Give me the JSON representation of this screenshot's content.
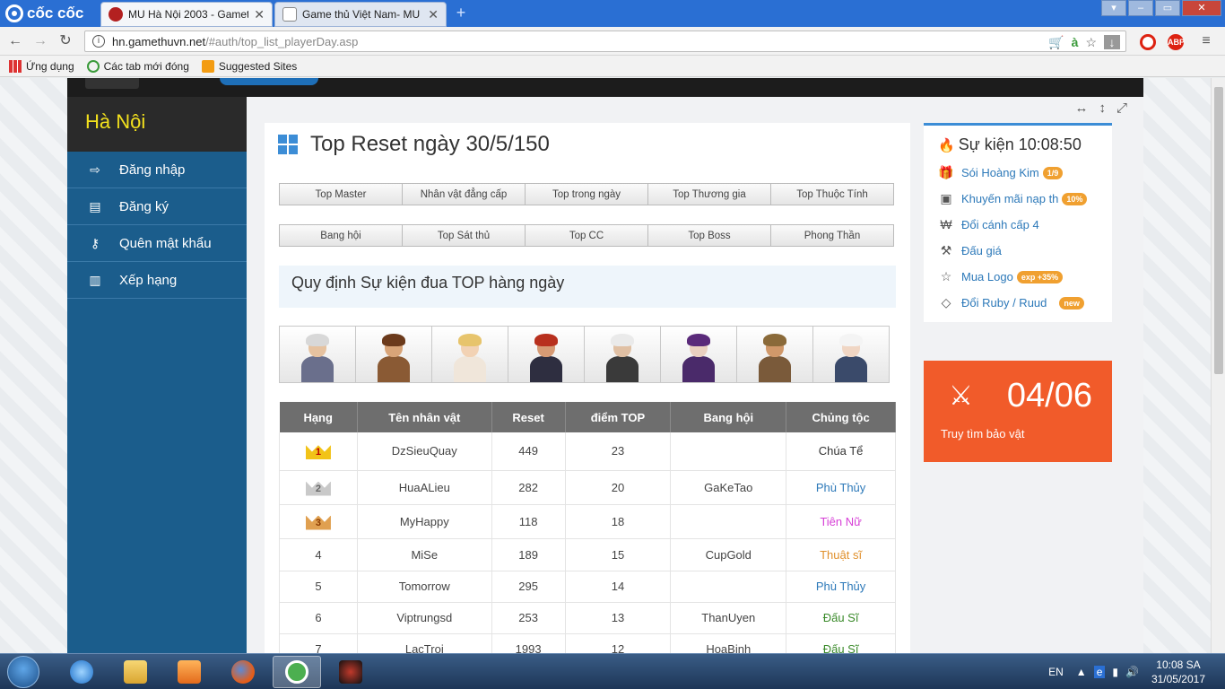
{
  "browser": {
    "brand": "cốc cốc",
    "tabs": [
      {
        "title": "MU Hà Nội 2003 - Gameth",
        "active": true
      },
      {
        "title": "Game thủ Việt Nam- MU H",
        "active": false
      }
    ],
    "url_host": "hn.gamethuvn.net",
    "url_path": "/#auth/top_list_playerDay.asp",
    "bookmarks": [
      "Ứng dụng",
      "Các tab mới đóng",
      "Suggested Sites"
    ]
  },
  "sidebar": {
    "title": "Hà Nội",
    "items": [
      {
        "label": "Đăng nhập",
        "icon": "sign-in-icon"
      },
      {
        "label": "Đăng ký",
        "icon": "document-icon"
      },
      {
        "label": "Quên mật khẩu",
        "icon": "key-icon"
      },
      {
        "label": "Xếp hạng",
        "icon": "bar-chart-icon"
      }
    ]
  },
  "main": {
    "title": "Top Reset ngày 30/5/150",
    "tabs_row1": [
      "Top Master",
      "Nhân vật đẳng cấp",
      "Top trong ngày",
      "Top Thương gia",
      "Top Thuộc Tính"
    ],
    "tabs_row2": [
      "Bang hội",
      "Top Sát thủ",
      "Top CC",
      "Top Boss",
      "Phong Thần"
    ],
    "rules_link": "Quy định Sự kiện đua TOP hàng ngày"
  },
  "table": {
    "headers": [
      "Hạng",
      "Tên nhân vật",
      "Reset",
      "điểm TOP",
      "Bang hội",
      "Chủng tộc"
    ],
    "rows": [
      {
        "rank": "1",
        "name": "DzSieuQuay",
        "reset": "449",
        "points": "23",
        "guild": "",
        "race": "Chúa Tể",
        "race_color": "#333333"
      },
      {
        "rank": "2",
        "name": "HuaALieu",
        "reset": "282",
        "points": "20",
        "guild": "GaKeTao",
        "race": "Phù Thủy",
        "race_color": "#2d79b9"
      },
      {
        "rank": "3",
        "name": "MyHappy",
        "reset": "118",
        "points": "18",
        "guild": "",
        "race": "Tiên Nữ",
        "race_color": "#d63fd6"
      },
      {
        "rank": "4",
        "name": "MiSe",
        "reset": "189",
        "points": "15",
        "guild": "CupGold",
        "race": "Thuật sĩ",
        "race_color": "#e0902c"
      },
      {
        "rank": "5",
        "name": "Tomorrow",
        "reset": "295",
        "points": "14",
        "guild": "",
        "race": "Phù Thủy",
        "race_color": "#2d79b9"
      },
      {
        "rank": "6",
        "name": "Viptrungsd",
        "reset": "253",
        "points": "13",
        "guild": "ThanUyen",
        "race": "Đấu Sĩ",
        "race_color": "#3a8a2a"
      },
      {
        "rank": "7",
        "name": "LacTroi",
        "reset": "1993",
        "points": "12",
        "guild": "HoaBinh",
        "race": "Đấu Sĩ",
        "race_color": "#3a8a2a"
      }
    ]
  },
  "event": {
    "title": "Sự kiện 10:08:50",
    "items": [
      {
        "label": "Sói Hoàng Kim",
        "badge": "1/9",
        "icon": "gift-icon"
      },
      {
        "label": "Khuyến mãi nạp th",
        "badge": "10%",
        "icon": "money-icon"
      },
      {
        "label": "Đổi cánh cấp 4",
        "badge": "",
        "icon": "won-icon"
      },
      {
        "label": "Đấu giá",
        "badge": "",
        "icon": "gavel-icon"
      },
      {
        "label": "Mua Logo",
        "badge": "exp +35%",
        "icon": "star-icon"
      },
      {
        "label": "Đổi Ruby / Ruud",
        "badge": "new",
        "icon": "diamond-icon"
      }
    ]
  },
  "treasure": {
    "count": "04/06",
    "label": "Truy tìm bảo vật"
  },
  "taskbar": {
    "lang": "EN",
    "time": "10:08 SA",
    "date": "31/05/2017"
  },
  "colors": {
    "sidebar": "#1b5d8c",
    "accent_orange": "#f15b2a",
    "link_blue": "#2d79b9",
    "sidebar_title": "#f3e11d"
  }
}
